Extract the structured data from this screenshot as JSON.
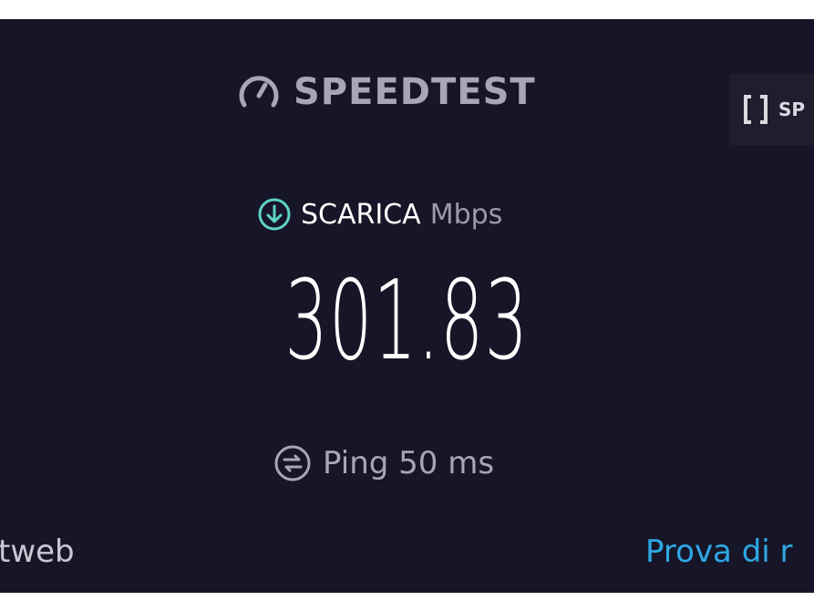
{
  "header": {
    "logo_text": "SPEEDTEST",
    "logo_icon": "speedometer-icon"
  },
  "fullscreen_button": {
    "label": "SP",
    "icon": "fullscreen-icon"
  },
  "download": {
    "label": "SCARICA",
    "unit": "Mbps",
    "value": "301.83",
    "icon": "download-arrow-icon",
    "icon_color": "#5fd3c5"
  },
  "ping": {
    "text": "Ping 50 ms",
    "icon": "ping-icon"
  },
  "footer": {
    "left_text": "tweb",
    "right_link": "Prova di r",
    "link_color": "#2fa8e6"
  }
}
